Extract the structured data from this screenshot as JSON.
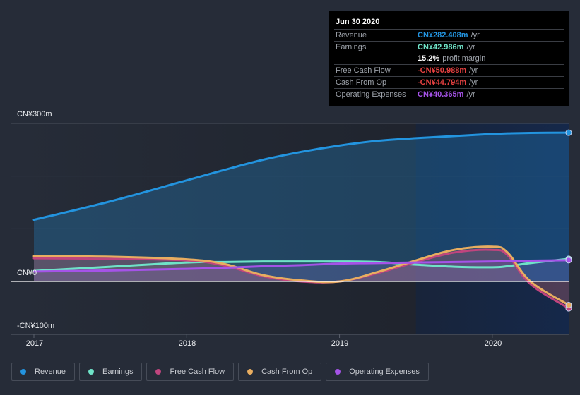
{
  "chart_data": {
    "type": "line",
    "title": "",
    "xlabel": "",
    "ylabel": "",
    "x_ticks": [
      "2017",
      "2018",
      "2019",
      "2020"
    ],
    "y_ticks": [
      "CN¥300m",
      "CN¥0",
      "-CN¥100m"
    ],
    "ylim": [
      -100,
      300
    ],
    "xlim": [
      2017.0,
      2020.5
    ],
    "grid": true,
    "legend_position": "bottom-left",
    "highlight_start": 2019.5,
    "x": [
      2017.0,
      2017.5,
      2018.0,
      2018.25,
      2018.5,
      2018.75,
      2019.0,
      2019.25,
      2019.5,
      2019.75,
      2020.0,
      2020.1,
      2020.25,
      2020.5
    ],
    "series": [
      {
        "name": "Revenue",
        "color": "#2394df",
        "values": [
          117,
          152,
          192,
          212,
          231,
          246,
          258,
          267,
          272,
          276,
          280,
          281,
          282,
          282.408
        ]
      },
      {
        "name": "Earnings",
        "color": "#6fe3c8",
        "values": [
          20,
          28,
          36,
          37,
          38,
          38,
          38,
          37,
          32,
          28,
          27,
          29,
          35,
          42.986
        ]
      },
      {
        "name": "Free Cash Flow",
        "color": "#c0457e",
        "values": [
          44,
          43,
          40,
          30,
          10,
          0,
          0,
          16,
          37,
          55,
          60,
          50,
          -5,
          -50.988
        ]
      },
      {
        "name": "Cash From Op",
        "color": "#e8ad60",
        "values": [
          48,
          47,
          42,
          33,
          12,
          2,
          0,
          18,
          40,
          60,
          66,
          55,
          0,
          -44.794
        ]
      },
      {
        "name": "Operating Expenses",
        "color": "#a553e8",
        "values": [
          19,
          21,
          24,
          26,
          29,
          31,
          34,
          35,
          36,
          37,
          38,
          38.5,
          39.5,
          40.365
        ]
      }
    ]
  },
  "tooltip": {
    "date": "Jun 30 2020",
    "rows": [
      {
        "label": "Revenue",
        "value": "CN¥282.408m",
        "unit": "/yr",
        "color": "#2394df"
      },
      {
        "label": "Earnings",
        "value": "CN¥42.986m",
        "unit": "/yr",
        "color": "#6fe3c8"
      },
      {
        "label": "",
        "value": "15.2%",
        "unit": "profit margin",
        "color": "#ffffff"
      },
      {
        "label": "Free Cash Flow",
        "value": "-CN¥50.988m",
        "unit": "/yr",
        "color": "#e64141"
      },
      {
        "label": "Cash From Op",
        "value": "-CN¥44.794m",
        "unit": "/yr",
        "color": "#e64141"
      },
      {
        "label": "Operating Expenses",
        "value": "CN¥40.365m",
        "unit": "/yr",
        "color": "#a553e8"
      }
    ]
  },
  "legend": [
    {
      "label": "Revenue",
      "color": "#2394df"
    },
    {
      "label": "Earnings",
      "color": "#6fe3c8"
    },
    {
      "label": "Free Cash Flow",
      "color": "#c0457e"
    },
    {
      "label": "Cash From Op",
      "color": "#e8ad60"
    },
    {
      "label": "Operating Expenses",
      "color": "#a553e8"
    }
  ]
}
